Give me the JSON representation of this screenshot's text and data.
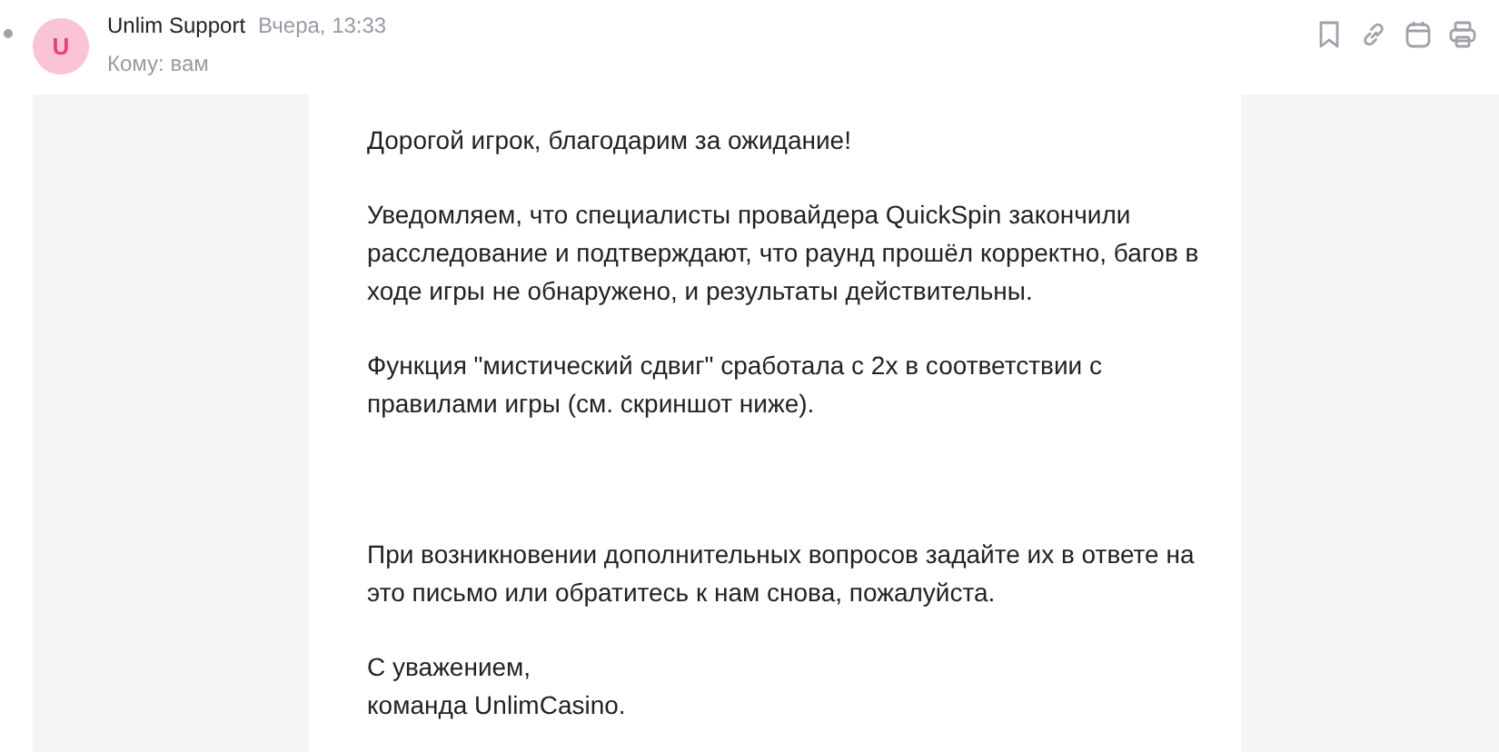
{
  "message": {
    "sender": "Unlim Support",
    "time": "Вчера, 13:33",
    "avatar_letter": "U",
    "recipient": "Кому: вам",
    "paragraphs": [
      "Дорогой игрок, благодарим за ожидание!",
      "Уведомляем, что специалисты провайдера QuickSpin закончили\nрасследование и подтверждают, что раунд прошёл корректно, багов в\nходе игры не обнаружено, и результаты действительны.",
      "Функция \"мистический сдвиг\" сработала с 2x в соответствии с\nправилами игры (см. скриншот ниже).",
      "При возникновении дополнительных вопросов задайте их в ответе на\nэто письмо или обратитесь к нам снова, пожалуйста.",
      "С уважением,\nкоманда UnlimCasino."
    ]
  }
}
